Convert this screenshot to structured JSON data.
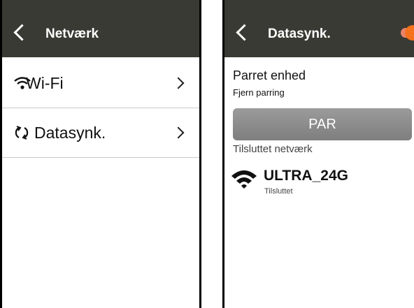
{
  "left_screen": {
    "title": "Netværk",
    "items": [
      {
        "label": "Wi-Fi",
        "icon": "wifi-icon"
      },
      {
        "label": "Datasynk.",
        "icon": "sync-icon"
      }
    ]
  },
  "right_screen": {
    "title": "Datasynk.",
    "toggle": {
      "state": "on",
      "color": "#f5711c"
    },
    "paired_device_title": "Parret enhed",
    "unpair_label": "Fjern parring",
    "pair_button_label": "PAR",
    "connected_network_label": "Tilsluttet netværk",
    "network": {
      "name": "ULTRA_24G",
      "status": "Tilsluttet",
      "icon": "wifi-signal-icon"
    }
  },
  "colors": {
    "header": "#3a3a34",
    "accent": "#f5711c",
    "button": "#8a8a8a"
  }
}
